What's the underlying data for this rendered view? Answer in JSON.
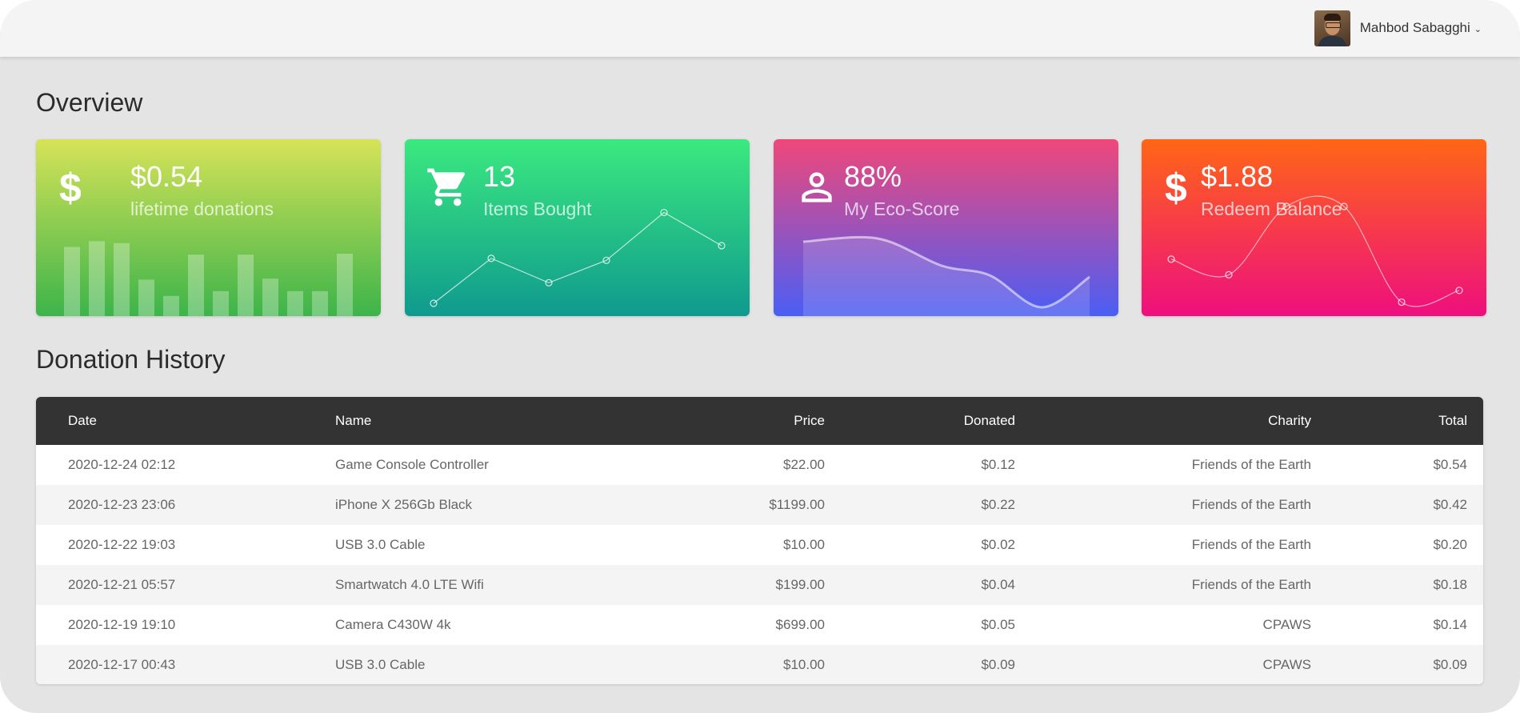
{
  "user": {
    "name": "Mahbod Sabagghi"
  },
  "overview": {
    "title": "Overview",
    "cards": [
      {
        "value": "$0.54",
        "label": "lifetime donations",
        "icon": "dollar-icon",
        "bars": [
          0.72,
          0.78,
          0.76,
          0.38,
          0.21,
          0.64,
          0.26,
          0.64,
          0.39,
          0.26,
          0.26,
          0.65
        ]
      },
      {
        "value": "13",
        "label": "Items Bought",
        "icon": "cart-icon",
        "points": [
          0.0,
          0.46,
          0.21,
          0.44,
          0.93,
          0.59
        ]
      },
      {
        "value": "88%",
        "label": "My Eco-Score",
        "icon": "user-icon",
        "points": [
          0.82,
          0.86,
          0.52,
          0.4,
          0.0,
          0.38
        ]
      },
      {
        "value": "$1.88",
        "label": "Redeem Balance",
        "icon": "dollar-icon",
        "points": [
          0.46,
          0.3,
          1.0,
          1.0,
          0.02,
          0.14
        ]
      }
    ]
  },
  "history": {
    "title": "Donation History",
    "columns": [
      "Date",
      "Name",
      "Price",
      "Donated",
      "Charity",
      "Total"
    ],
    "rows": [
      [
        "2020-12-24 02:12",
        "Game Console Controller",
        "$22.00",
        "$0.12",
        "Friends of the Earth",
        "$0.54"
      ],
      [
        "2020-12-23 23:06",
        "iPhone X 256Gb Black",
        "$1199.00",
        "$0.22",
        "Friends of the Earth",
        "$0.42"
      ],
      [
        "2020-12-22 19:03",
        "USB 3.0 Cable",
        "$10.00",
        "$0.02",
        "Friends of the Earth",
        "$0.20"
      ],
      [
        "2020-12-21 05:57",
        "Smartwatch 4.0 LTE Wifi",
        "$199.00",
        "$0.04",
        "Friends of the Earth",
        "$0.18"
      ],
      [
        "2020-12-19 19:10",
        "Camera C430W 4k",
        "$699.00",
        "$0.05",
        "CPAWS",
        "$0.14"
      ],
      [
        "2020-12-17 00:43",
        "USB 3.0 Cable",
        "$10.00",
        "$0.09",
        "CPAWS",
        "$0.09"
      ]
    ]
  }
}
